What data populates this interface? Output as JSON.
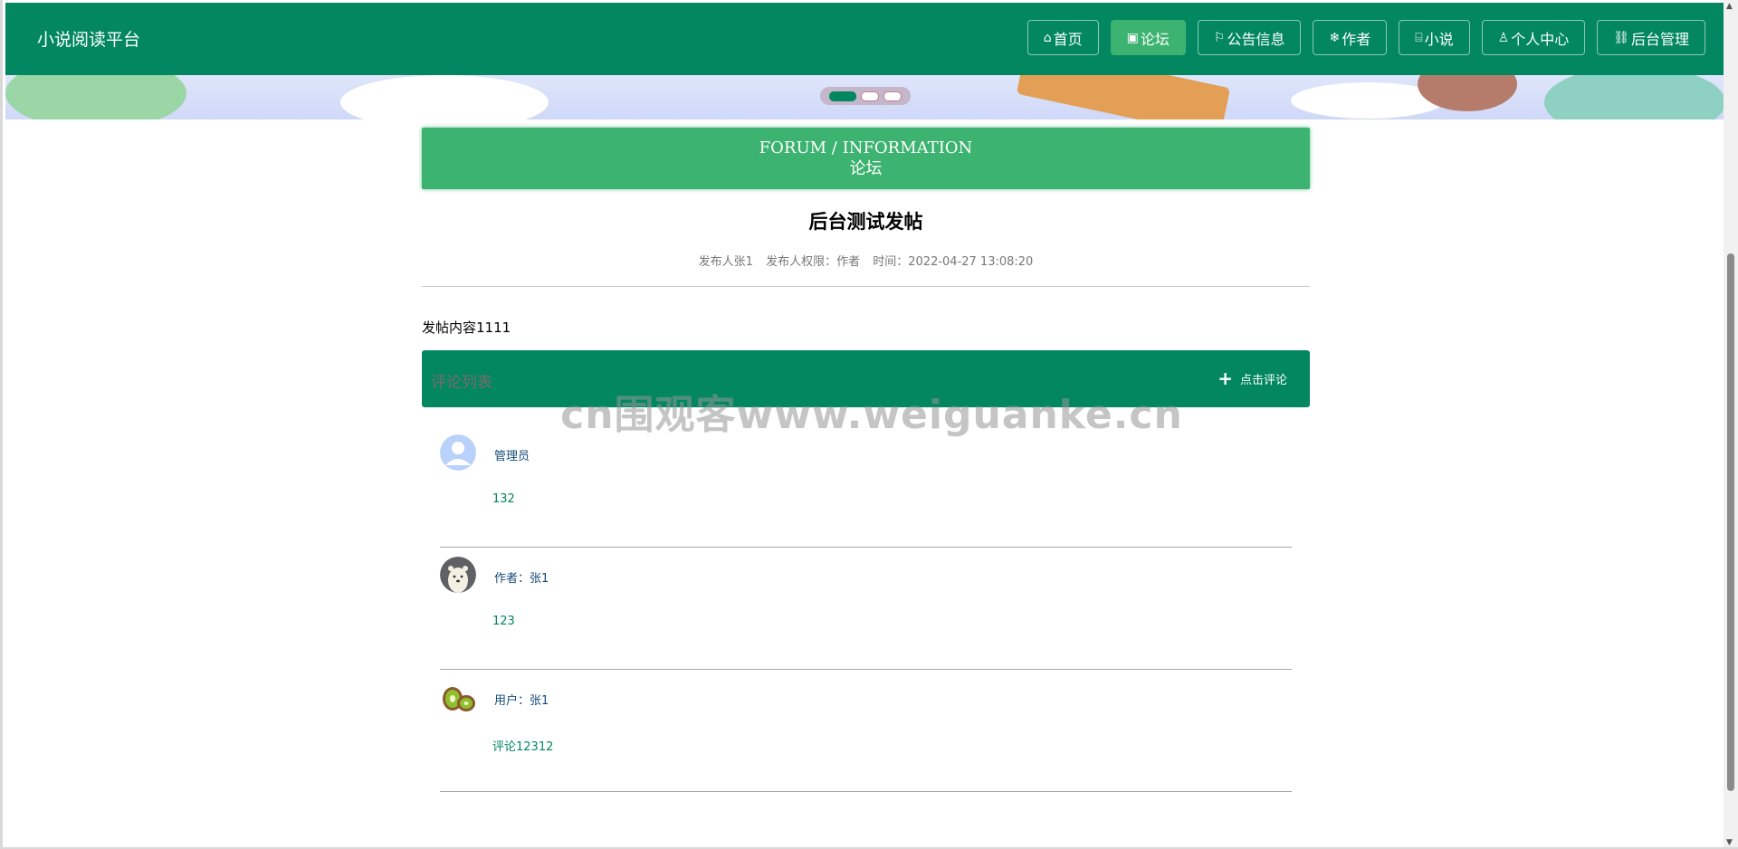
{
  "brand": "小说阅读平台",
  "nav": [
    {
      "icon": "⌂",
      "label": "首页",
      "active": false
    },
    {
      "icon": "▣",
      "label": "论坛",
      "active": true
    },
    {
      "icon": "⚐",
      "label": "公告信息",
      "active": false
    },
    {
      "icon": "❄",
      "label": "作者",
      "active": false
    },
    {
      "icon": "⌸",
      "label": "小说",
      "active": false
    },
    {
      "icon": "♙",
      "label": "个人中心",
      "active": false
    },
    {
      "icon": "⛓",
      "label": "后台管理",
      "active": false
    }
  ],
  "section": {
    "title_en": "FORUM / INFORMATION",
    "title_cn": "论坛"
  },
  "post": {
    "title": "后台测试发帖",
    "author": "发布人张1",
    "role": "发布人权限：作者",
    "time": "时间：2022-04-27 13:08:20",
    "content": "发帖内容1111"
  },
  "comments_bar": {
    "label": "评论列表",
    "add_label": "点击评论",
    "add_icon": "+"
  },
  "comments": [
    {
      "name": "管理员",
      "text": "132",
      "avatar": "default-person-avatar"
    },
    {
      "name": "作者：张1",
      "text": "123",
      "avatar": "polar-bear-avatar"
    },
    {
      "name": "用户：张1",
      "text": "评论12312",
      "avatar": "kiwi-fruit-avatar"
    }
  ],
  "watermark": "cn围观客www.weiguanke.cn",
  "colors": {
    "primary": "#028760",
    "accent": "#3db371",
    "comment_text": "#028760",
    "name_text": "#154b7a"
  }
}
